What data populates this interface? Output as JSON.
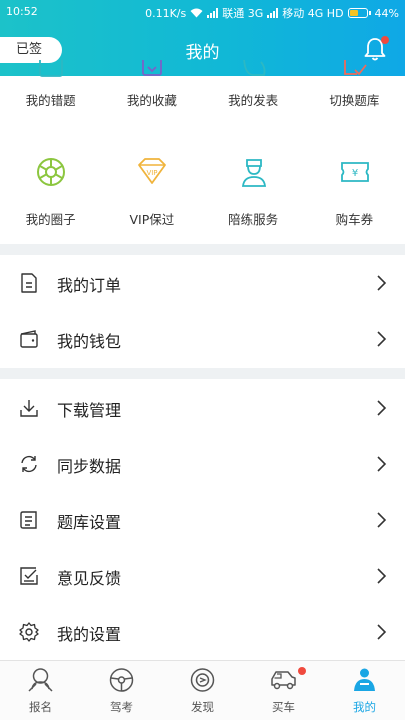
{
  "status_bar": {
    "time": "10:52",
    "speed": "0.11K/s",
    "carrier1": "联通 3G",
    "carrier2": "移动 4G HD",
    "battery": "44%"
  },
  "header": {
    "signed_label": "已签",
    "title": "我的"
  },
  "grid": {
    "row1": [
      {
        "label": "我的错题",
        "icon": "wrong-questions-icon"
      },
      {
        "label": "我的收藏",
        "icon": "favorites-icon"
      },
      {
        "label": "我的发表",
        "icon": "posts-icon"
      },
      {
        "label": "切换题库",
        "icon": "switch-bank-icon"
      }
    ],
    "row2": [
      {
        "label": "我的圈子",
        "icon": "circle-icon"
      },
      {
        "label": "VIP保过",
        "icon": "vip-diamond-icon"
      },
      {
        "label": "陪练服务",
        "icon": "coach-icon"
      },
      {
        "label": "购车券",
        "icon": "coupon-icon"
      }
    ]
  },
  "menu_group1": [
    {
      "label": "我的订单",
      "icon": "order-icon"
    },
    {
      "label": "我的钱包",
      "icon": "wallet-icon"
    }
  ],
  "menu_group2": [
    {
      "label": "下载管理",
      "icon": "download-icon"
    },
    {
      "label": "同步数据",
      "icon": "sync-icon"
    },
    {
      "label": "题库设置",
      "icon": "bank-settings-icon"
    },
    {
      "label": "意见反馈",
      "icon": "feedback-icon"
    },
    {
      "label": "我的设置",
      "icon": "gear-icon"
    }
  ],
  "bottom_nav": [
    {
      "label": "报名",
      "icon": "signup-icon"
    },
    {
      "label": "驾考",
      "icon": "steering-wheel-icon"
    },
    {
      "label": "发现",
      "icon": "discover-icon"
    },
    {
      "label": "买车",
      "icon": "car-icon"
    },
    {
      "label": "我的",
      "icon": "profile-icon"
    }
  ],
  "colors": {
    "header_start": "#1cc2c9",
    "header_end": "#0fa8e6",
    "accent": "#1aa6e4",
    "badge": "#f04a3e",
    "icon_green": "#8cc63f",
    "icon_gold": "#f0b43c",
    "icon_teal": "#2cb8c4"
  }
}
